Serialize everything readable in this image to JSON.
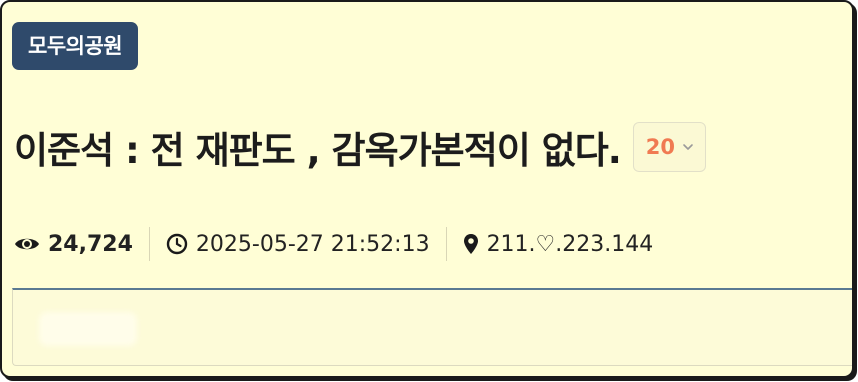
{
  "post": {
    "category": "모두의공원",
    "title": "이준석 : 전 재판도 , 감옥가본적이 없다.",
    "comment_count": "20",
    "views": "24,724",
    "datetime": "2025-05-27 21:52:13",
    "ip": "211.♡.223.144"
  },
  "icons": {
    "views": "eye-icon",
    "datetime": "clock-icon",
    "ip": "map-marker-icon",
    "comment_toggle": "chevron-down-icon"
  },
  "colors": {
    "background": "#fffed6",
    "category_badge": "#2f4a6b",
    "comment_count": "#f07a52",
    "content_border": "#5a7a92"
  }
}
